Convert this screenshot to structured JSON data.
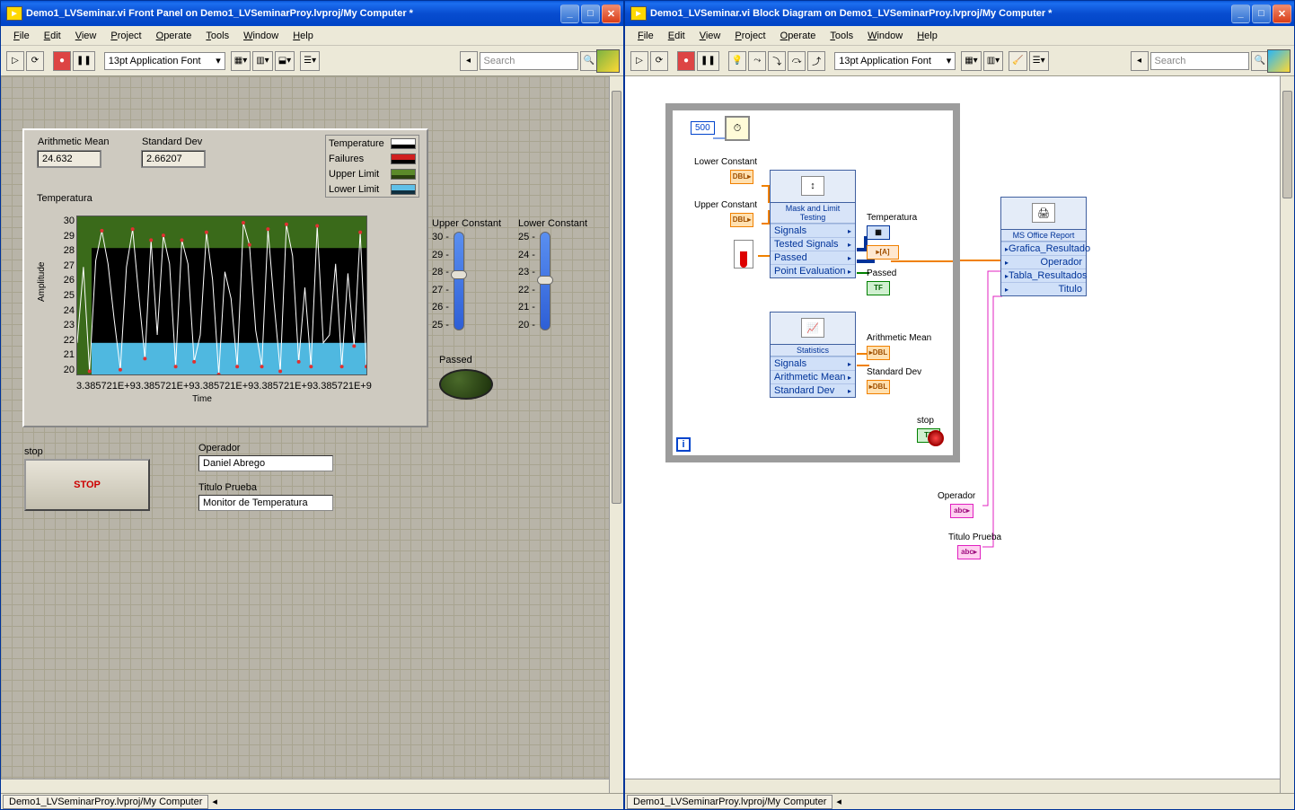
{
  "front": {
    "title": "Demo1_LVSeminar.vi Front Panel on Demo1_LVSeminarProy.lvproj/My Computer *",
    "menu": [
      "File",
      "Edit",
      "View",
      "Project",
      "Operate",
      "Tools",
      "Window",
      "Help"
    ],
    "font": "13pt Application Font",
    "search_ph": "Search",
    "arith_mean": {
      "label": "Arithmetic Mean",
      "value": "24.632"
    },
    "std_dev": {
      "label": "Standard Dev",
      "value": "2.66207"
    },
    "legend": [
      {
        "name": "Temperature",
        "color": "#ffffff",
        "bg": "#000"
      },
      {
        "name": "Failures",
        "color": "#d02020",
        "bg": "#000"
      },
      {
        "name": "Upper Limit",
        "color": "#5b8a2a",
        "bg": "#2a4010"
      },
      {
        "name": "Lower Limit",
        "color": "#5fc0e8",
        "bg": "#103040"
      }
    ],
    "chart": {
      "title": "Temperatura",
      "ylabel": "Amplitude",
      "xlabel": "Time",
      "yticks": [
        "30",
        "29",
        "28",
        "27",
        "26",
        "25",
        "24",
        "23",
        "22",
        "21",
        "20"
      ],
      "xticks": [
        "3.385721E+9",
        "3.385721E+9",
        "3.385721E+9",
        "3.385721E+9",
        "3.385721E+9"
      ]
    },
    "upper": {
      "label": "Upper Constant",
      "ticks": [
        "30",
        "29",
        "28",
        "27",
        "26",
        "25"
      ],
      "knob_pct": 42
    },
    "lower": {
      "label": "Lower Constant",
      "ticks": [
        "25",
        "24",
        "23",
        "22",
        "21",
        "20"
      ],
      "knob_pct": 48
    },
    "passed": {
      "label": "Passed"
    },
    "stop": {
      "label": "stop",
      "button": "STOP"
    },
    "operador": {
      "label": "Operador",
      "value": "Daniel Abrego"
    },
    "titulo": {
      "label": "Titulo Prueba",
      "value": "Monitor de Temperatura"
    },
    "status": "Demo1_LVSeminarProy.lvproj/My Computer"
  },
  "block": {
    "title": "Demo1_LVSeminar.vi Block Diagram on Demo1_LVSeminarProy.lvproj/My Computer *",
    "menu": [
      "File",
      "Edit",
      "View",
      "Project",
      "Operate",
      "Tools",
      "Window",
      "Help"
    ],
    "font": "13pt Application Font",
    "search_ph": "Search",
    "const500": "500",
    "lower_const": "Lower Constant",
    "upper_const": "Upper Constant",
    "mlt": {
      "name": "Mask and Limit Testing",
      "rows": [
        "Signals",
        "Tested Signals",
        "Passed",
        "Point Evaluation"
      ]
    },
    "stats": {
      "name": "Statistics",
      "rows": [
        "Signals",
        "Arithmetic Mean",
        "Standard Dev"
      ]
    },
    "report": {
      "name": "MS Office Report",
      "rows": [
        "Grafica_Resultado",
        "Operador",
        "Tabla_Resultados",
        "Titulo"
      ]
    },
    "out_temp": "Temperatura",
    "out_passed": "Passed",
    "out_mean": "Arithmetic Mean",
    "out_std": "Standard Dev",
    "out_stop": "stop",
    "out_oper": "Operador",
    "out_titulo": "Titulo Prueba",
    "status": "Demo1_LVSeminarProy.lvproj/My Computer"
  },
  "chart_data": {
    "type": "line",
    "title": "Temperatura",
    "xlabel": "Time",
    "ylabel": "Amplitude",
    "ylim": [
      20,
      30
    ],
    "upper_limit": 28,
    "lower_limit": 22,
    "series": [
      {
        "name": "Temperature",
        "values": [
          22,
          26.8,
          20.2,
          27.2,
          29.1,
          27.0,
          23.5,
          20.3,
          26.8,
          29.2,
          25.0,
          21.0,
          28.5,
          22.5,
          28.8,
          27.0,
          20.5,
          28.5,
          27.0,
          20.8,
          22.5,
          29.0,
          26.0,
          20.0,
          26.5,
          24.8,
          20.5,
          29.6,
          28.2,
          22.8,
          20.5,
          29.2,
          24.5,
          20.2,
          29.5,
          27.5,
          20.8,
          25.5,
          20.5,
          29.4,
          22.0,
          22.5,
          27.0,
          20.5,
          26.4,
          21.8,
          29.0,
          20.5
        ]
      }
    ]
  }
}
